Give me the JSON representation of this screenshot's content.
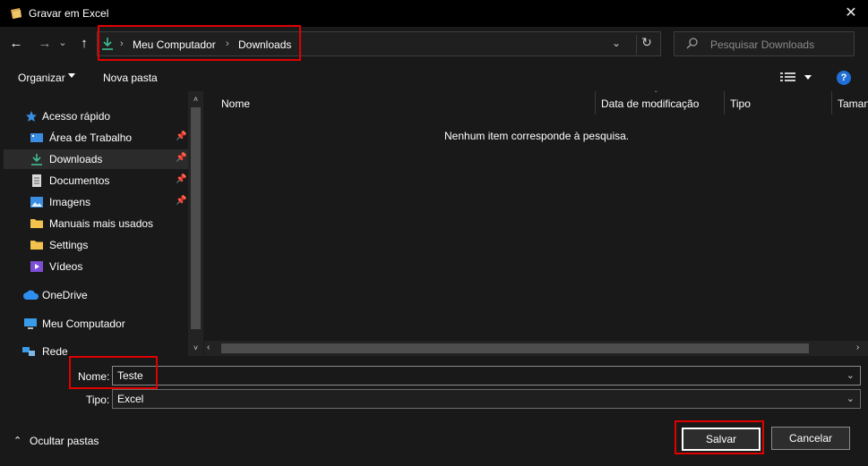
{
  "window": {
    "title": "Gravar em Excel",
    "close": "✕"
  },
  "nav": {
    "back": "←",
    "forward": "→",
    "recent": "⌄",
    "up": "↑"
  },
  "address": {
    "crumbs": [
      "Meu Computador",
      "Downloads"
    ],
    "separator": "›",
    "dropdown": "⌄",
    "refresh": "↻"
  },
  "search": {
    "placeholder": "Pesquisar Downloads"
  },
  "toolbar": {
    "organize": "Organizar",
    "new_folder": "Nova pasta",
    "help": "?"
  },
  "sidebar": {
    "items": [
      {
        "label": "Acesso rápido",
        "icon": "star-icon",
        "pinned": false
      },
      {
        "label": "Área de Trabalho",
        "icon": "desktop-icon",
        "pinned": true
      },
      {
        "label": "Downloads",
        "icon": "download-icon",
        "pinned": true
      },
      {
        "label": "Documentos",
        "icon": "document-icon",
        "pinned": true
      },
      {
        "label": "Imagens",
        "icon": "pictures-icon",
        "pinned": true
      },
      {
        "label": "Manuais mais usados",
        "icon": "folder-icon",
        "pinned": false
      },
      {
        "label": "Settings",
        "icon": "folder-icon",
        "pinned": false
      },
      {
        "label": "Vídeos",
        "icon": "videos-icon",
        "pinned": false
      },
      {
        "label": "OneDrive",
        "icon": "cloud-icon",
        "pinned": false
      },
      {
        "label": "Meu Computador",
        "icon": "computer-icon",
        "pinned": false
      },
      {
        "label": "Rede",
        "icon": "network-icon",
        "pinned": false
      }
    ]
  },
  "columns": [
    "Nome",
    "Data de modificação",
    "Tipo",
    "Taman"
  ],
  "empty_message": "Nenhum item corresponde à pesquisa.",
  "save_form": {
    "name_label": "Nome:",
    "name_value": "Teste",
    "type_label": "Tipo:",
    "type_value": "Excel",
    "hide_folders": "Ocultar pastas",
    "save": "Salvar",
    "cancel": "Cancelar"
  },
  "colors": {
    "background": "#191919",
    "titlebar": "#000000",
    "highlight": "#e00000",
    "accent_download": "#3fbf8f",
    "help": "#1f6fd6"
  }
}
